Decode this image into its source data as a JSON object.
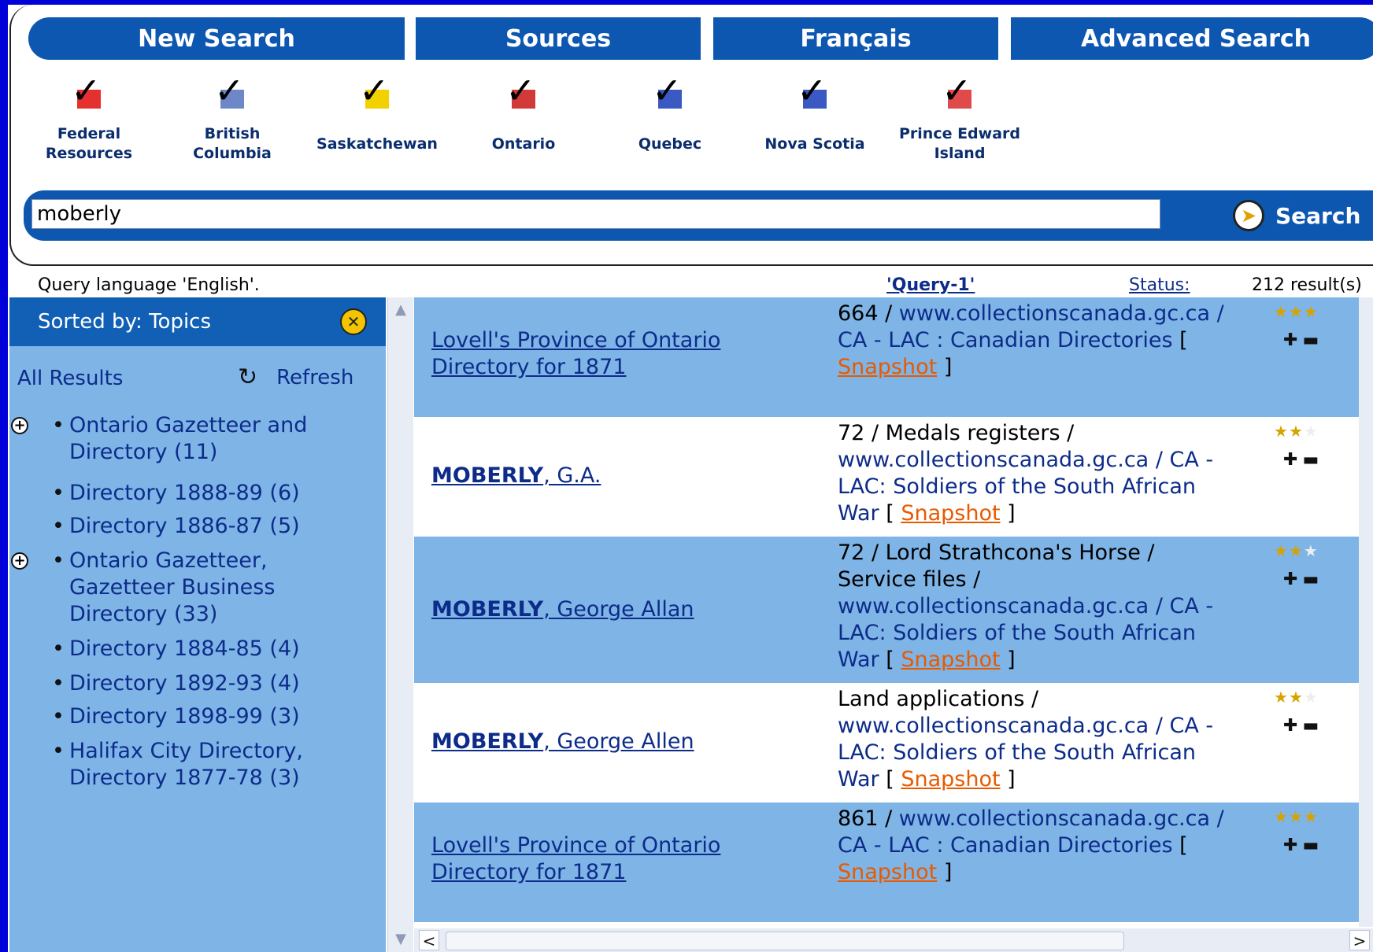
{
  "nav": {
    "new_search": "New Search",
    "sources": "Sources",
    "francais": "Français",
    "advanced_search": "Advanced Search"
  },
  "provinces": [
    {
      "label": "Federal\nResources",
      "flag_color": "#e53030"
    },
    {
      "label": "British Columbia",
      "flag_color": "#6d87c9"
    },
    {
      "label": "Saskatchewan",
      "flag_color": "#f1d100"
    },
    {
      "label": "Ontario",
      "flag_color": "#d23a3a"
    },
    {
      "label": "Quebec",
      "flag_color": "#3a59c2"
    },
    {
      "label": "Nova Scotia",
      "flag_color": "#3a59c2"
    },
    {
      "label": "Prince Edward\nIsland",
      "flag_color": "#e04a4a"
    }
  ],
  "search": {
    "value": "moberly",
    "button_label": "Search"
  },
  "status": {
    "query_language": "Query language 'English'.",
    "query_name": "'Query-1'",
    "status_label": "Status:",
    "result_count": "212 result(s)"
  },
  "sidebar": {
    "sorted_by": "Sorted by:  Topics",
    "all_results": "All Results",
    "refresh": "Refresh",
    "topics": [
      {
        "label": "Ontario Gazetteer and Directory (11)",
        "expandable": true
      },
      {
        "label": "Directory 1888-89 (6)",
        "expandable": false
      },
      {
        "label": "Directory 1886-87 (5)",
        "expandable": false
      },
      {
        "label": "Ontario Gazetteer, Gazetteer Business Directory (33)",
        "expandable": true
      },
      {
        "label": "Directory 1884-85 (4)",
        "expandable": false
      },
      {
        "label": "Directory 1892-93 (4)",
        "expandable": false
      },
      {
        "label": "Directory 1898-99 (3)",
        "expandable": false
      },
      {
        "label": "Halifax City Directory, Directory 1877-78 (3)",
        "expandable": false
      }
    ]
  },
  "results": [
    {
      "title_bold": "",
      "title_rest": "Lovell's Province of Ontario Directory for 1871",
      "info_prefix": "664 /",
      "site": "www.collectionscanada.gc.ca / CA - LAC : Canadian Directories",
      "snapshot": "Snapshot",
      "rating": 3
    },
    {
      "title_bold": "MOBERLY",
      "title_rest": ", G.A.",
      "info_prefix": "72 / Medals registers /",
      "site": "www.collectionscanada.gc.ca / CA - LAC: Soldiers of the South African War",
      "snapshot": "Snapshot",
      "rating": 2
    },
    {
      "title_bold": "MOBERLY",
      "title_rest": ", George Allan",
      "info_prefix": "72 / Lord Strathcona's Horse / Service files /",
      "site": "www.collectionscanada.gc.ca / CA - LAC: Soldiers of the South African War",
      "snapshot": "Snapshot",
      "rating": 2
    },
    {
      "title_bold": "MOBERLY",
      "title_rest": ", George Allen",
      "info_prefix": "Land applications /",
      "site": "www.collectionscanada.gc.ca / CA - LAC: Soldiers of the South African War",
      "snapshot": "Snapshot",
      "rating": 2
    },
    {
      "title_bold": "",
      "title_rest": "Lovell's Province of Ontario Directory for 1871",
      "info_prefix": "861 /",
      "site": "www.collectionscanada.gc.ca / CA - LAC : Canadian Directories",
      "snapshot": "Snapshot",
      "rating": 3
    }
  ]
}
